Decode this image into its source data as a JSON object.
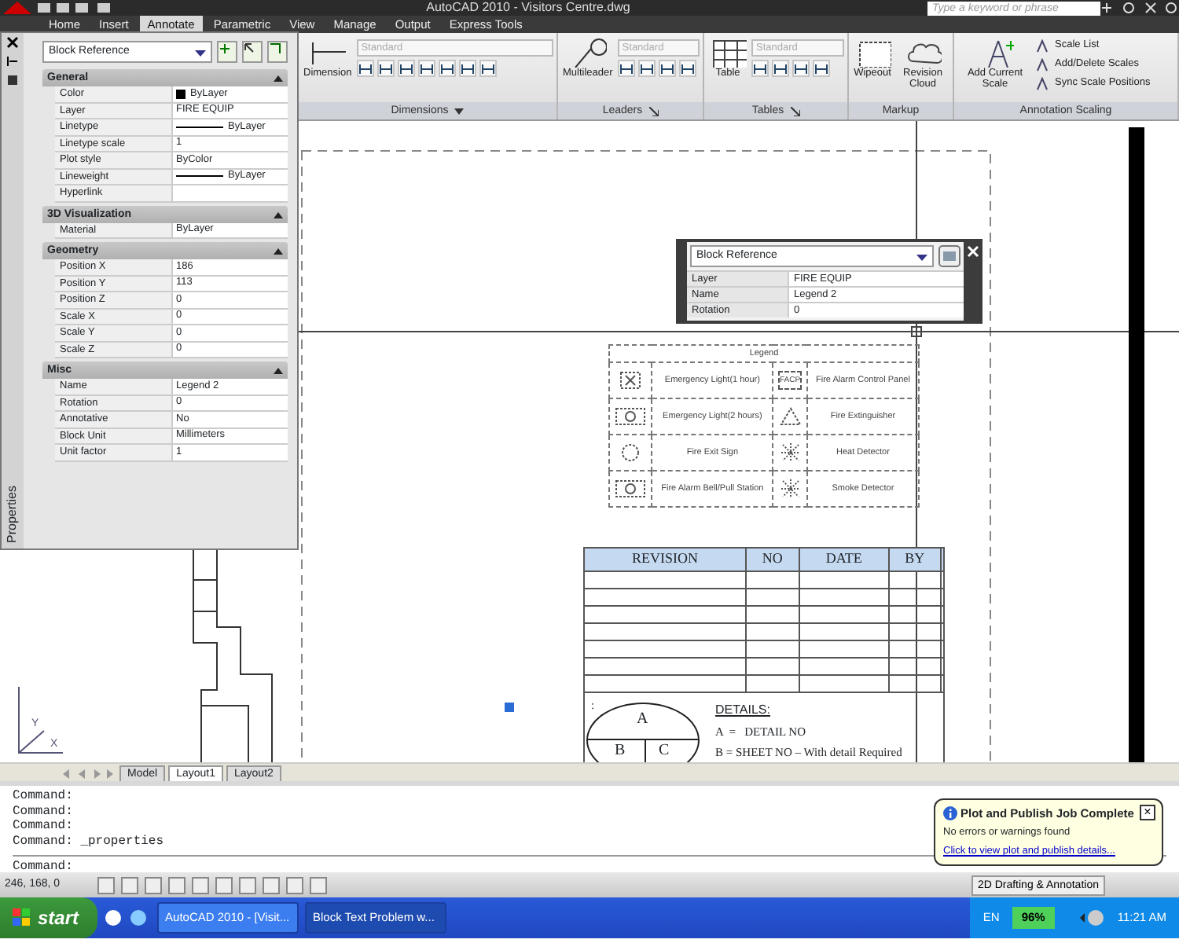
{
  "window": {
    "title": "AutoCAD 2010 - Visitors Centre.dwg",
    "search": {
      "placeholder": "Type a keyword or phrase"
    }
  },
  "ribbon_tabs": [
    {
      "label": "Home",
      "selected": false
    },
    {
      "label": "Insert",
      "selected": false
    },
    {
      "label": "Annotate",
      "selected": true
    },
    {
      "label": "Parametric",
      "selected": false
    },
    {
      "label": "View",
      "selected": false
    },
    {
      "label": "Manage",
      "selected": false
    },
    {
      "label": "Output",
      "selected": false
    },
    {
      "label": "Express Tools",
      "selected": false
    }
  ],
  "ribbon_panels": [
    {
      "title": "Dimensions",
      "expander": {
        "kind": "menu"
      },
      "big_tools": [
        {
          "label": "Dimension",
          "kind": "dimension"
        }
      ],
      "style": "Standard",
      "small_tools": [
        {
          "kind": "tool"
        },
        {
          "kind": "tool"
        },
        {
          "kind": "tool"
        },
        {
          "kind": "tool"
        },
        {
          "kind": "tool"
        },
        {
          "kind": "tool"
        },
        {
          "kind": "tool"
        }
      ]
    },
    {
      "title": "Leaders",
      "expander": {
        "kind": "dialog"
      },
      "big_tools": [
        {
          "label": "Multileader",
          "kind": "leader"
        }
      ],
      "style": "Standard",
      "small_tools": [
        {
          "kind": "tool"
        },
        {
          "kind": "tool"
        },
        {
          "kind": "tool"
        },
        {
          "kind": "tool"
        }
      ]
    },
    {
      "title": "Tables",
      "expander": {
        "kind": "dialog"
      },
      "big_tools": [
        {
          "label": "Table",
          "kind": "table"
        }
      ],
      "style": "Standard",
      "small_tools": [
        {
          "kind": "tool"
        },
        {
          "kind": "tool"
        },
        {
          "kind": "tool"
        },
        {
          "kind": "tool"
        }
      ]
    },
    {
      "title": "Markup",
      "big_tools": [
        {
          "label": "Wipeout",
          "kind": "wipeout"
        },
        {
          "label": "Revision Cloud",
          "kind": "cloud"
        }
      ]
    },
    {
      "title": "Annotation Scaling",
      "big_tools": [
        {
          "label": "Add Current Scale",
          "kind": "scale"
        }
      ],
      "list_tools": [
        "Scale List",
        "Add/Delete Scales",
        "Sync Scale Positions"
      ]
    }
  ],
  "properties_palette": {
    "side_label": "Properties",
    "object_type": "Block Reference",
    "sections": [
      {
        "title": "General",
        "rows": [
          {
            "label": "Color",
            "value": "ByLayer",
            "kind": "color"
          },
          {
            "label": "Layer",
            "value": "FIRE EQUIP",
            "kind": "text"
          },
          {
            "label": "Linetype",
            "value": "ByLayer",
            "kind": "line"
          },
          {
            "label": "Linetype scale",
            "value": "1",
            "kind": "text"
          },
          {
            "label": "Plot style",
            "value": "ByColor",
            "kind": "text"
          },
          {
            "label": "Lineweight",
            "value": "ByLayer",
            "kind": "line"
          },
          {
            "label": "Hyperlink",
            "value": "",
            "kind": "text"
          }
        ]
      },
      {
        "title": "3D Visualization",
        "rows": [
          {
            "label": "Material",
            "value": "ByLayer",
            "kind": "text"
          }
        ]
      },
      {
        "title": "Geometry",
        "rows": [
          {
            "label": "Position X",
            "value": "186",
            "kind": "text"
          },
          {
            "label": "Position Y",
            "value": "113",
            "kind": "text"
          },
          {
            "label": "Position Z",
            "value": "0",
            "kind": "text"
          },
          {
            "label": "Scale X",
            "value": "0",
            "kind": "text"
          },
          {
            "label": "Scale Y",
            "value": "0",
            "kind": "text"
          },
          {
            "label": "Scale Z",
            "value": "0",
            "kind": "text"
          }
        ]
      },
      {
        "title": "Misc",
        "rows": [
          {
            "label": "Name",
            "value": "Legend 2",
            "kind": "text"
          },
          {
            "label": "Rotation",
            "value": "0",
            "kind": "text"
          },
          {
            "label": "Annotative",
            "value": "No",
            "kind": "text"
          },
          {
            "label": "Block Unit",
            "value": "Millimeters",
            "kind": "text"
          },
          {
            "label": "Unit factor",
            "value": "1",
            "kind": "text"
          }
        ]
      }
    ]
  },
  "quick_properties": {
    "object_type": "Block Reference",
    "rows": [
      {
        "label": "Layer",
        "value": "FIRE EQUIP"
      },
      {
        "label": "Name",
        "value": "Legend 2"
      },
      {
        "label": "Rotation",
        "value": "0"
      }
    ]
  },
  "drawing": {
    "legend": {
      "title": "Legend",
      "entries": [
        {
          "label": "Emergency Light(1 hour)",
          "symbol": {
            "kind": "box"
          }
        },
        {
          "label": "Fire Alarm Control Panel",
          "symbol": {
            "kind": "text",
            "text": "FACP"
          }
        },
        {
          "label": "Emergency Light(2 hours)",
          "symbol": {
            "kind": "wide"
          }
        },
        {
          "label": "Fire Extinguisher",
          "symbol": {
            "kind": "triangle"
          }
        },
        {
          "label": "Fire Exit Sign",
          "symbol": {
            "kind": "circle"
          }
        },
        {
          "label": "Heat Detector",
          "symbol": {
            "kind": "star"
          }
        },
        {
          "label": "Fire Alarm Bell/Pull Station",
          "symbol": {
            "kind": "wide"
          }
        },
        {
          "label": "Smoke Detector",
          "symbol": {
            "kind": "star"
          }
        }
      ]
    },
    "ucs_icon": {
      "y_label": "Y",
      "x_label": "X"
    },
    "revision_table": {
      "columns": [
        "REVISION",
        "NO",
        "DATE",
        "BY"
      ]
    },
    "details": {
      "mark": ":",
      "bubble": [
        "A",
        "B",
        "C"
      ],
      "heading": "DETAILS:",
      "lines": [
        "A  =   DETAIL NO",
        "B = SHEET NO – With detail Required"
      ]
    }
  },
  "layout_tabs": [
    {
      "label": "Model",
      "selected": false
    },
    {
      "label": "Layout1",
      "selected": true
    },
    {
      "label": "Layout2",
      "selected": false
    }
  ],
  "command_history": [
    "Command:",
    "Command:",
    "Command:",
    "Command: _properties"
  ],
  "command_prompt": "Command:",
  "status_bar": {
    "coordinates": "246, 168, 0",
    "workspace": "2D Drafting & Annotation"
  },
  "notification": {
    "close": "×",
    "title": "Plot and Publish Job Complete",
    "message": "No errors or warnings found",
    "link": "Click to view plot and publish details..."
  },
  "taskbar": {
    "start": "start",
    "tasks": [
      {
        "label": "AutoCAD 2010 - [Visit...",
        "selected": false
      },
      {
        "label": "Block Text Problem w...",
        "selected": true
      }
    ],
    "language": "EN",
    "battery": "96%",
    "clock": "11:21 AM"
  }
}
